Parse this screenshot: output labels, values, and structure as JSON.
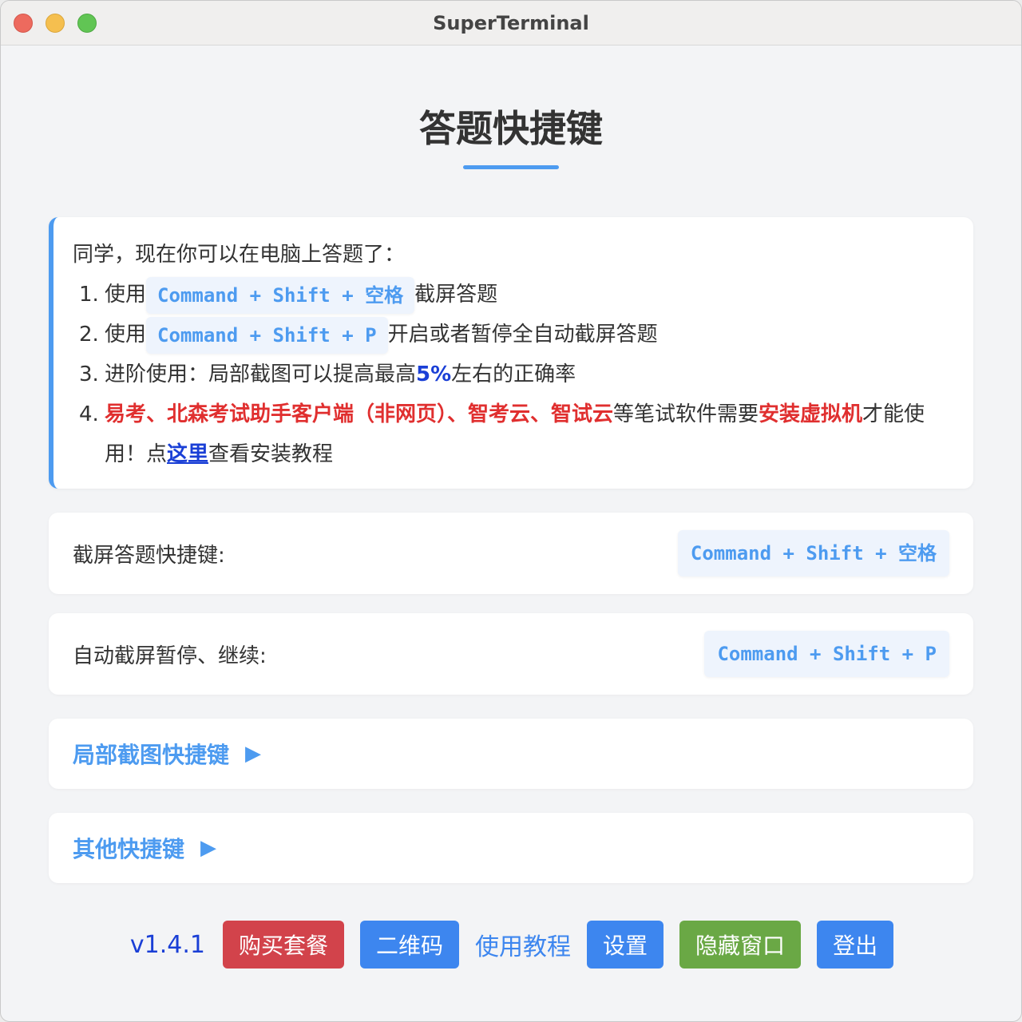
{
  "window": {
    "title": "SuperTerminal",
    "controls": [
      "close",
      "minimize",
      "zoom"
    ]
  },
  "page": {
    "title": "答题快捷键"
  },
  "intro": {
    "greeting": "同学，现在你可以在电脑上答题了：",
    "items": [
      {
        "num": "1.",
        "prefix": "使用",
        "kbd": "Command + Shift + 空格",
        "suffix": "截屏答题"
      },
      {
        "num": "2.",
        "prefix": "使用",
        "kbd": "Command + Shift + P",
        "suffix": "开启或者暂停全自动截屏答题"
      },
      {
        "num": "3.",
        "prefix": "进阶使用：局部截图可以提高最高",
        "highlight": "5%",
        "suffix": "左右的正确率"
      },
      {
        "num": "4.",
        "red1": "易考、北森考试助手客户端（非网页）、智考云、智试云",
        "mid": "等笔试软件需要",
        "red2": "安装虚拟机",
        "tail": "才能使用！点",
        "link": "这里",
        "end": "查看安装教程"
      }
    ]
  },
  "shortcuts": [
    {
      "label": "截屏答题快捷键:",
      "kbd": "Command + Shift + 空格"
    },
    {
      "label": "自动截屏暂停、继续:",
      "kbd": "Command + Shift + P"
    }
  ],
  "sections": [
    {
      "title": "局部截图快捷键",
      "arrow": "▶"
    },
    {
      "title": "其他快捷键",
      "arrow": "▶"
    }
  ],
  "footer": {
    "version": "v1.4.1",
    "buy": "购买套餐",
    "qrcode": "二维码",
    "tutorial": "使用教程",
    "settings": "设置",
    "hide": "隐藏窗口",
    "logout": "登出"
  },
  "colors": {
    "accent": "#4d9bf0",
    "danger": "#d2434b",
    "success": "#6aa845",
    "highlight_text": "#e02f2f",
    "link": "#1a3fd6"
  }
}
